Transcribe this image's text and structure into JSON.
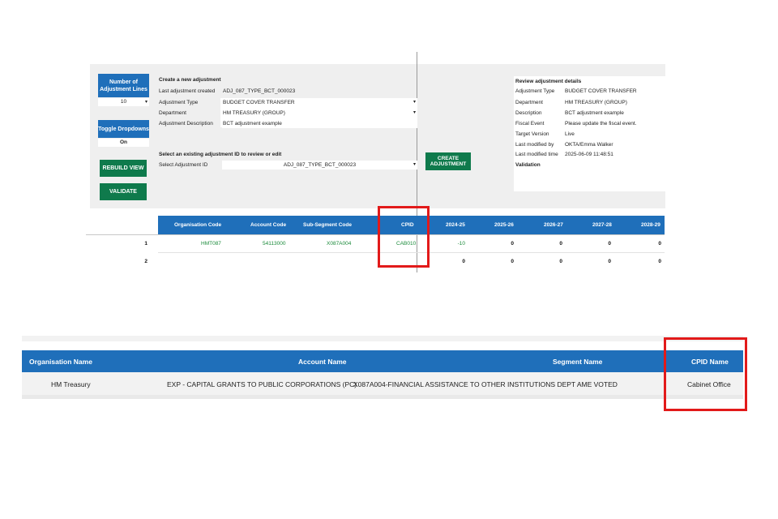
{
  "controls": {
    "num_lines_label": "Number of Adjustment Lines",
    "num_lines_value": "10",
    "toggle_label": "Toggle Dropdowns",
    "toggle_value": "On",
    "rebuild_label": "REBUILD VIEW",
    "validate_label": "VALIDATE"
  },
  "create": {
    "heading": "Create a new adjustment",
    "last_created_label": "Last adjustment created",
    "last_created_value": "ADJ_087_TYPE_BCT_000023",
    "type_label": "Adjustment Type",
    "type_value": "BUDGET COVER TRANSFER",
    "dept_label": "Department",
    "dept_value": "HM TREASURY (GROUP)",
    "desc_label": "Adjustment Description",
    "desc_value": "BCT adjustment example",
    "select_heading": "Select an existing adjustment ID to review or edit",
    "select_label": "Select Adjustment ID",
    "select_value": "ADJ_087_TYPE_BCT_000023",
    "create_button": "CREATE ADJUSTMENT"
  },
  "review": {
    "heading": "Review adjustment details",
    "rows": [
      {
        "label": "Adjustment Type",
        "value": "BUDGET COVER TRANSFER"
      },
      {
        "label": "Department",
        "value": "HM TREASURY (GROUP)"
      },
      {
        "label": "Description",
        "value": "BCT adjustment example"
      },
      {
        "label": "Fiscal Event",
        "value": "Please update the fiscal event."
      },
      {
        "label": "Target Version",
        "value": "Live"
      },
      {
        "label": "Last modified by",
        "value": "OKTA/Emma Walker"
      },
      {
        "label": "Last modified time",
        "value": "2025-06-09 11:48:51"
      }
    ],
    "validation_label": "Validation"
  },
  "grid": {
    "headers": [
      "Organisation Code",
      "Account Code",
      "Sub-Segment Code",
      "CPID",
      "2024-25",
      "2025-26",
      "2026-27",
      "2027-28",
      "2028-29"
    ],
    "rows": [
      {
        "num": "1",
        "org": "HMT087",
        "acc": "54113000",
        "seg": "X087A004",
        "cpid": "CAB010",
        "y1": "-10",
        "y2": "0",
        "y3": "0",
        "y4": "0",
        "y5": "0"
      },
      {
        "num": "2",
        "org": "",
        "acc": "",
        "seg": "",
        "cpid": "",
        "y1": "0",
        "y2": "0",
        "y3": "0",
        "y4": "0",
        "y5": "0"
      }
    ]
  },
  "lookup": {
    "headers": [
      "Organisation Name",
      "Account Name",
      "Segment Name",
      "CPID Name"
    ],
    "row": {
      "org": "HM Treasury",
      "acc": "EXP - CAPITAL GRANTS TO PUBLIC CORPORATIONS (PC)",
      "seg": "X087A004-FINANCIAL ASSISTANCE TO OTHER INSTITUTIONS DEPT AME VOTED",
      "cpid": "Cabinet Office"
    }
  },
  "colors": {
    "header_blue": "#1f6fba",
    "button_green": "#0f7a4c",
    "highlight_red": "#e21a1a",
    "value_green": "#1a8a3a"
  }
}
